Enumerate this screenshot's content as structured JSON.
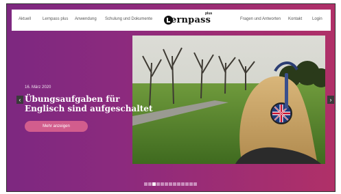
{
  "nav": {
    "left_items": [
      "Aktuell",
      "Lernpass plus",
      "Anwendung",
      "Schulung und Dokumente"
    ],
    "right_items": [
      "Fragen und Antworten",
      "Kontakt",
      "Login"
    ],
    "logo_text": "ernpass",
    "logo_sup": "plus"
  },
  "slide": {
    "date": "16. März 2020",
    "headline": "Übungsaufgaben für Englisch sind aufgeschaltet",
    "cta_label": "Mehr anzeigen",
    "prev_icon": "‹",
    "next_icon": "›"
  },
  "carousel": {
    "total": 13,
    "active_index": 2
  },
  "colors": {
    "accent": "#d25d8d",
    "bg_start": "#7d2880",
    "bg_end": "#b03068"
  },
  "icons": [
    "chevron-left-icon",
    "chevron-right-icon"
  ]
}
